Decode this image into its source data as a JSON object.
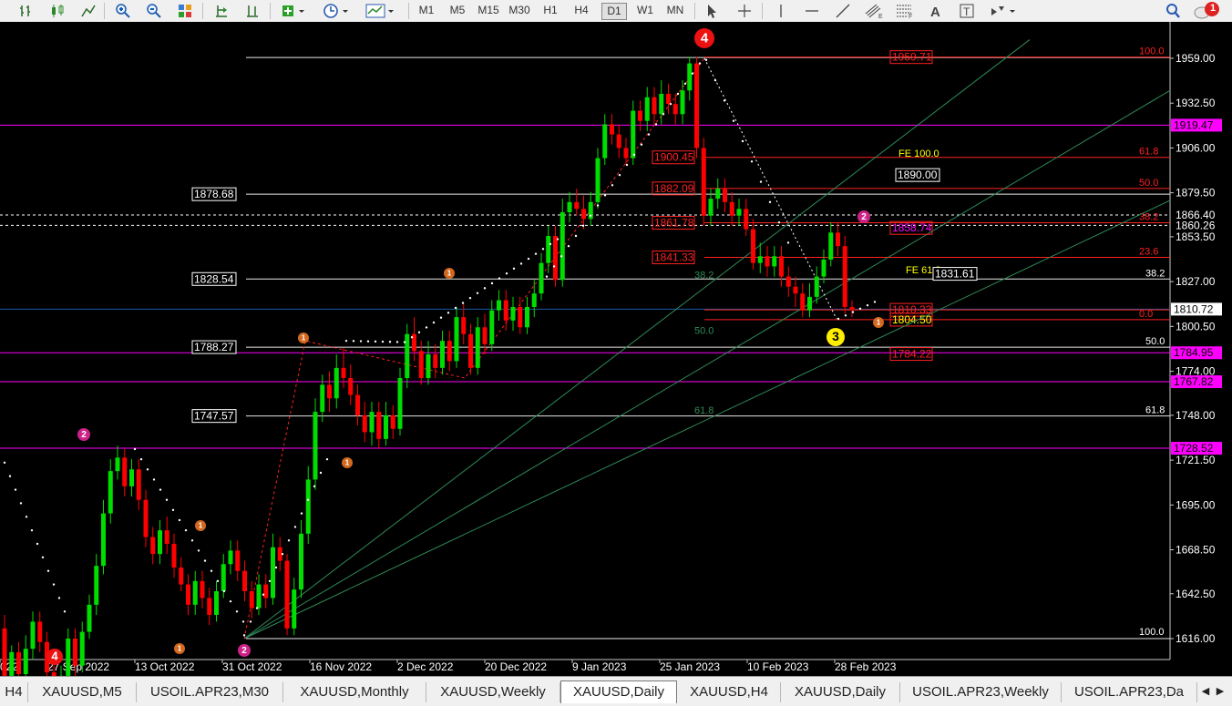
{
  "toolbar": {
    "timeframes": [
      "M1",
      "M5",
      "M15",
      "M30",
      "H1",
      "H4",
      "D1",
      "W1",
      "MN"
    ],
    "active_timeframe": "D1",
    "notification_count": "1"
  },
  "chart": {
    "symbol": "XAUUSD",
    "period": "Daily",
    "price_axis": [
      "1959.00",
      "1932.50",
      "1906.00",
      "1879.50",
      "1853.50",
      "1827.00",
      "1800.50",
      "1774.00",
      "1748.00",
      "1721.50",
      "1695.00",
      "1668.50",
      "1642.50",
      "1616.00"
    ],
    "date_axis": [
      "022",
      "27 Sep 2022",
      "13 Oct 2022",
      "31 Oct 2022",
      "16 Nov 2022",
      "2 Dec 2022",
      "20 Dec 2022",
      "9 Jan 2023",
      "25 Jan 2023",
      "10 Feb 2023",
      "28 Feb 2023"
    ],
    "current_price": "1810.72",
    "dashed_price_labels": [
      "1866.40",
      "1860.26"
    ],
    "magenta_levels": [
      "1919.47",
      "1784.95",
      "1767.82",
      "1728.52"
    ],
    "retracement_1": {
      "levels": [
        "100.0",
        "61.8",
        "50.0",
        "38.2",
        "23.6",
        "0.0"
      ],
      "prices": [
        "1959.71",
        "1900.45",
        "1882.09",
        "1861.78",
        "1841.33",
        "1810.33",
        "1804.50"
      ]
    },
    "retracement_2": {
      "levels": [
        "100.0",
        "61.8",
        "50.0",
        "38.2"
      ],
      "prices": [
        "1878.68",
        "1828.54",
        "1788.27",
        "1747.57"
      ]
    },
    "fib_fan_labels": [
      "38.2",
      "50.0",
      "61.8"
    ],
    "expansion_labels": [
      "FE 100.0",
      "1890.00",
      "FE 61.8",
      "1831.61",
      "1858.74",
      "1784.22"
    ],
    "wave_labels": [
      "4",
      "3",
      "2",
      "1",
      "2",
      "1",
      "1",
      "1",
      "1",
      "1",
      "2",
      "4"
    ],
    "colors": {
      "bull_candle": "#00dd00",
      "bear_candle": "#ff0000",
      "fib_red": "#ff2020",
      "magenta": "#ff00ff",
      "fan_green": "#2e8b57",
      "wave_red": "#ee1111",
      "wave_orange": "#d2691e",
      "wave_yellow": "#ffee00",
      "wave_pink": "#cc2288"
    },
    "candles": [
      [
        1622,
        1594,
        1630,
        1590
      ],
      [
        1594,
        1608,
        1612,
        1590
      ],
      [
        1608,
        1595,
        1614,
        1588
      ],
      [
        1595,
        1610,
        1618,
        1592
      ],
      [
        1610,
        1626,
        1632,
        1604
      ],
      [
        1626,
        1614,
        1632,
        1608
      ],
      [
        1614,
        1596,
        1620,
        1590
      ],
      [
        1596,
        1576,
        1602,
        1570
      ],
      [
        1576,
        1594,
        1600,
        1570
      ],
      [
        1594,
        1616,
        1622,
        1590
      ],
      [
        1616,
        1600,
        1622,
        1594
      ],
      [
        1600,
        1620,
        1626,
        1596
      ],
      [
        1620,
        1636,
        1642,
        1616
      ],
      [
        1636,
        1659,
        1666,
        1630
      ],
      [
        1659,
        1690,
        1698,
        1654
      ],
      [
        1690,
        1715,
        1722,
        1684
      ],
      [
        1715,
        1723,
        1730,
        1710
      ],
      [
        1723,
        1706,
        1728,
        1700
      ],
      [
        1706,
        1716,
        1722,
        1700
      ],
      [
        1716,
        1698,
        1722,
        1692
      ],
      [
        1698,
        1676,
        1704,
        1670
      ],
      [
        1676,
        1666,
        1682,
        1660
      ],
      [
        1666,
        1680,
        1686,
        1660
      ],
      [
        1680,
        1672,
        1688,
        1666
      ],
      [
        1672,
        1658,
        1678,
        1652
      ],
      [
        1658,
        1648,
        1664,
        1644
      ],
      [
        1648,
        1636,
        1654,
        1630
      ],
      [
        1636,
        1650,
        1656,
        1630
      ],
      [
        1650,
        1640,
        1656,
        1634
      ],
      [
        1640,
        1630,
        1646,
        1624
      ],
      [
        1630,
        1644,
        1650,
        1626
      ],
      [
        1644,
        1660,
        1666,
        1640
      ],
      [
        1660,
        1668,
        1674,
        1654
      ],
      [
        1668,
        1656,
        1674,
        1650
      ],
      [
        1656,
        1644,
        1662,
        1638
      ],
      [
        1644,
        1634,
        1650,
        1628
      ],
      [
        1634,
        1648,
        1654,
        1630
      ],
      [
        1648,
        1640,
        1654,
        1634
      ],
      [
        1640,
        1670,
        1678,
        1636
      ],
      [
        1670,
        1662,
        1676,
        1656
      ],
      [
        1662,
        1622,
        1666,
        1618
      ],
      [
        1622,
        1645,
        1652,
        1618
      ],
      [
        1645,
        1678,
        1686,
        1640
      ],
      [
        1678,
        1710,
        1718,
        1672
      ],
      [
        1710,
        1750,
        1758,
        1704
      ],
      [
        1750,
        1766,
        1772,
        1744
      ],
      [
        1766,
        1758,
        1774,
        1750
      ],
      [
        1758,
        1776,
        1784,
        1752
      ],
      [
        1776,
        1770,
        1788,
        1764
      ],
      [
        1770,
        1760,
        1778,
        1754
      ],
      [
        1760,
        1748,
        1766,
        1742
      ],
      [
        1748,
        1738,
        1756,
        1732
      ],
      [
        1738,
        1750,
        1756,
        1730
      ],
      [
        1750,
        1734,
        1756,
        1728
      ],
      [
        1734,
        1748,
        1756,
        1730
      ],
      [
        1748,
        1740,
        1754,
        1734
      ],
      [
        1740,
        1770,
        1776,
        1736
      ],
      [
        1770,
        1796,
        1802,
        1764
      ],
      [
        1796,
        1786,
        1806,
        1780
      ],
      [
        1786,
        1770,
        1792,
        1766
      ],
      [
        1770,
        1784,
        1792,
        1766
      ],
      [
        1784,
        1776,
        1790,
        1770
      ],
      [
        1776,
        1792,
        1798,
        1772
      ],
      [
        1792,
        1780,
        1798,
        1774
      ],
      [
        1780,
        1806,
        1812,
        1776
      ],
      [
        1806,
        1796,
        1814,
        1790
      ],
      [
        1796,
        1776,
        1802,
        1772
      ],
      [
        1776,
        1800,
        1806,
        1772
      ],
      [
        1800,
        1790,
        1808,
        1784
      ],
      [
        1790,
        1810,
        1816,
        1786
      ],
      [
        1810,
        1816,
        1822,
        1804
      ],
      [
        1816,
        1804,
        1822,
        1798
      ],
      [
        1804,
        1812,
        1818,
        1798
      ],
      [
        1812,
        1800,
        1818,
        1796
      ],
      [
        1800,
        1812,
        1818,
        1796
      ],
      [
        1812,
        1820,
        1828,
        1806
      ],
      [
        1820,
        1838,
        1844,
        1816
      ],
      [
        1838,
        1854,
        1860,
        1832
      ],
      [
        1854,
        1828,
        1860,
        1824
      ],
      [
        1828,
        1868,
        1876,
        1824
      ],
      [
        1868,
        1874,
        1880,
        1862
      ],
      [
        1874,
        1870,
        1882,
        1866
      ],
      [
        1870,
        1864,
        1878,
        1858
      ],
      [
        1864,
        1874,
        1880,
        1860
      ],
      [
        1874,
        1900,
        1906,
        1870
      ],
      [
        1900,
        1920,
        1926,
        1896
      ],
      [
        1920,
        1914,
        1926,
        1908
      ],
      [
        1914,
        1906,
        1920,
        1900
      ],
      [
        1906,
        1900,
        1912,
        1896
      ],
      [
        1900,
        1928,
        1934,
        1896
      ],
      [
        1928,
        1922,
        1934,
        1916
      ],
      [
        1922,
        1936,
        1942,
        1916
      ],
      [
        1936,
        1926,
        1942,
        1920
      ],
      [
        1926,
        1938,
        1946,
        1920
      ],
      [
        1938,
        1932,
        1944,
        1926
      ],
      [
        1932,
        1926,
        1938,
        1920
      ],
      [
        1926,
        1940,
        1946,
        1920
      ],
      [
        1940,
        1956,
        1960,
        1934
      ],
      [
        1956,
        1906,
        1960,
        1900
      ],
      [
        1906,
        1866,
        1912,
        1860
      ],
      [
        1866,
        1876,
        1882,
        1860
      ],
      [
        1876,
        1882,
        1888,
        1870
      ],
      [
        1882,
        1874,
        1888,
        1868
      ],
      [
        1874,
        1866,
        1880,
        1860
      ],
      [
        1866,
        1870,
        1876,
        1860
      ],
      [
        1870,
        1858,
        1876,
        1854
      ],
      [
        1858,
        1838,
        1864,
        1834
      ],
      [
        1838,
        1842,
        1850,
        1832
      ],
      [
        1842,
        1836,
        1848,
        1830
      ],
      [
        1836,
        1842,
        1848,
        1830
      ],
      [
        1842,
        1830,
        1848,
        1824
      ],
      [
        1830,
        1824,
        1836,
        1818
      ],
      [
        1824,
        1820,
        1830,
        1812
      ],
      [
        1820,
        1810,
        1826,
        1806
      ],
      [
        1810,
        1818,
        1826,
        1806
      ],
      [
        1818,
        1830,
        1836,
        1814
      ],
      [
        1830,
        1840,
        1846,
        1826
      ],
      [
        1840,
        1856,
        1862,
        1836
      ],
      [
        1856,
        1848,
        1862,
        1842
      ],
      [
        1848,
        1812,
        1854,
        1808
      ],
      [
        1812,
        1810,
        1816,
        1806
      ]
    ]
  },
  "tabs": [
    "H4",
    "XAUUSD,M5",
    "USOIL.APR23,M30",
    "XAUUSD,Monthly",
    "XAUUSD,Weekly",
    "XAUUSD,Daily",
    "XAUUSD,H4",
    "XAUUSD,Daily",
    "USOIL.APR23,Weekly",
    "USOIL.APR23,Da"
  ],
  "active_tab_index": 5
}
